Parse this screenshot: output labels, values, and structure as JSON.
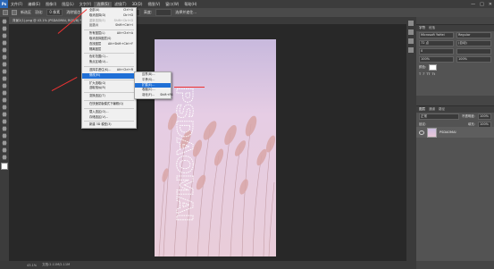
{
  "menubar": {
    "app_logo": "Ps",
    "items": [
      "文件(F)",
      "编辑(E)",
      "图像(I)",
      "图层(L)",
      "文字(Y)",
      "选择(S)",
      "滤镜(T)",
      "3D(D)",
      "视图(V)",
      "窗口(W)",
      "帮助(H)"
    ],
    "active_index": 5,
    "window_controls": [
      "—",
      "□",
      "✕"
    ]
  },
  "options_bar": {
    "new_selection_label": "新选区",
    "feather_label": "羽化:",
    "feather_value": "0 像素",
    "antialias_label": "消除锯齿",
    "style_label": "样式:",
    "style_value": "正常",
    "width_label": "宽度:",
    "height_label": "高度:",
    "refine_button": "选择并遮住..."
  },
  "document_tab": {
    "title": "背景2(1).png @ 43.1% (PSDAOMAI, RGB/8) *"
  },
  "select_menu": {
    "items": [
      {
        "label": "全部(A)",
        "shortcut": "Ctrl+A",
        "disabled": false
      },
      {
        "label": "取消选择(D)",
        "shortcut": "Ctrl+D",
        "disabled": false
      },
      {
        "label": "重新选择(E)",
        "shortcut": "Shift+Ctrl+D",
        "disabled": true
      },
      {
        "label": "反选(I)",
        "shortcut": "Shift+Ctrl+I",
        "disabled": false
      },
      {
        "sep": true
      },
      {
        "label": "所有图层(L)",
        "shortcut": "Alt+Ctrl+A",
        "disabled": false
      },
      {
        "label": "取消选择图层(S)",
        "shortcut": "",
        "disabled": false
      },
      {
        "label": "查找图层",
        "shortcut": "Alt+Shift+Ctrl+F",
        "disabled": false
      },
      {
        "label": "隔离图层",
        "shortcut": "",
        "disabled": false
      },
      {
        "sep": true
      },
      {
        "label": "色彩范围(C)...",
        "shortcut": "",
        "disabled": false
      },
      {
        "label": "焦点区域(U)...",
        "shortcut": "",
        "disabled": false
      },
      {
        "sep": true
      },
      {
        "label": "选择并遮住(K)...",
        "shortcut": "Alt+Ctrl+R",
        "disabled": false
      },
      {
        "label": "修改(M)",
        "shortcut": "",
        "disabled": false,
        "highlight": true
      },
      {
        "sep": true
      },
      {
        "label": "扩大选取(G)",
        "shortcut": "",
        "disabled": false
      },
      {
        "label": "选取相似(R)",
        "shortcut": "",
        "disabled": false
      },
      {
        "sep": true
      },
      {
        "label": "变换选区(T)",
        "shortcut": "",
        "disabled": false
      },
      {
        "sep": true
      },
      {
        "label": "在快速蒙版模式下编辑(Q)",
        "shortcut": "",
        "disabled": false
      },
      {
        "sep": true
      },
      {
        "label": "载入选区(O)...",
        "shortcut": "",
        "disabled": false
      },
      {
        "label": "存储选区(V)...",
        "shortcut": "",
        "disabled": false
      },
      {
        "sep": true
      },
      {
        "label": "新建 3D 模型(3)",
        "shortcut": "",
        "disabled": false
      }
    ]
  },
  "modify_submenu": {
    "items": [
      {
        "label": "边界(B)...",
        "shortcut": "",
        "highlight": false
      },
      {
        "label": "平滑(S)...",
        "shortcut": "",
        "highlight": false
      },
      {
        "label": "扩展(E)...",
        "shortcut": "",
        "highlight": true
      },
      {
        "label": "收缩(C)...",
        "shortcut": "",
        "highlight": false
      },
      {
        "label": "羽化(F)...",
        "shortcut": "Shift+F6",
        "highlight": false
      }
    ]
  },
  "canvas": {
    "watermark_text": "PSDAOMAI"
  },
  "status_bar": {
    "zoom": "43.1%",
    "doc_info": "文档:2.11M/2.11M"
  },
  "properties_panel": {
    "tabs": [
      "字符",
      "段落"
    ],
    "font_family": "Microsoft YaHei",
    "font_style": "Regular",
    "font_size": "72 点",
    "leading": "(自动)",
    "tracking": "0",
    "scale_v": "100%",
    "scale_h": "100%",
    "color_label": "颜色:"
  },
  "layers_panel": {
    "tabs": [
      "图层",
      "通道",
      "路径"
    ],
    "blend_mode": "正常",
    "opacity_label": "不透明度:",
    "opacity_value": "100%",
    "lock_label": "锁定:",
    "fill_label": "填充:",
    "fill_value": "100%",
    "layer_name": "PSDAOMAI"
  },
  "colors": {
    "accent": "#1f6fd6",
    "arrow": "#e33333"
  }
}
